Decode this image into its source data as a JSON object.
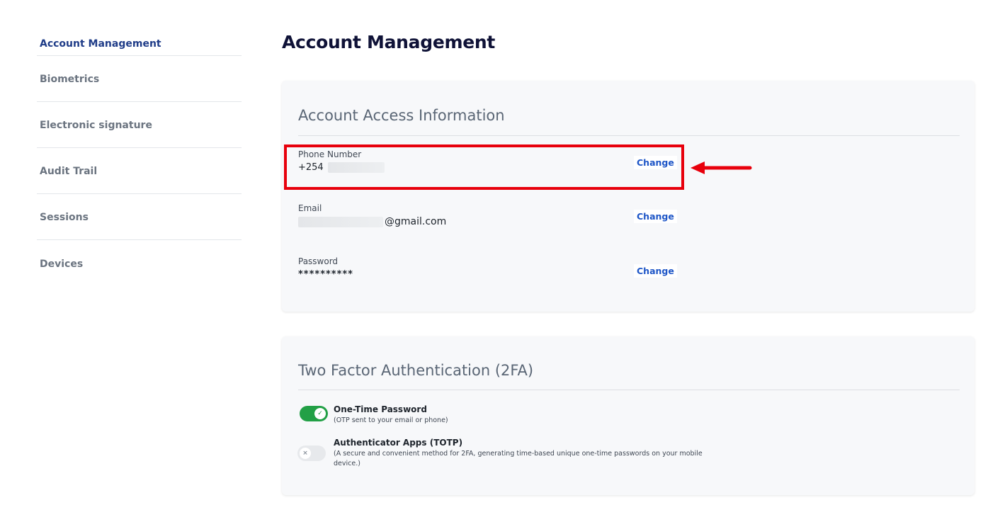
{
  "sidebar": {
    "items": [
      {
        "label": "Account Management"
      },
      {
        "label": "Biometrics"
      },
      {
        "label": "Electronic signature"
      },
      {
        "label": "Audit Trail"
      },
      {
        "label": "Sessions"
      },
      {
        "label": "Devices"
      }
    ],
    "active_color": "#1f3c88",
    "inactive_color": "#6b7480"
  },
  "page": {
    "title": "Account Management"
  },
  "access": {
    "title": "Account Access Information",
    "phone": {
      "label": "Phone Number",
      "value_prefix": "+254",
      "change_label": "Change"
    },
    "email": {
      "label": "Email",
      "value_suffix": "@gmail.com",
      "change_label": "Change"
    },
    "password": {
      "label": "Password",
      "value": "**********",
      "change_label": "Change"
    }
  },
  "twofa": {
    "title": "Two Factor Authentication (2FA)",
    "options": [
      {
        "title": "One-Time Password",
        "description": "(OTP sent to your email or phone)",
        "enabled": true,
        "icon": "check-icon"
      },
      {
        "title": "Authenticator Apps (TOTP)",
        "description": "(A secure and convenient method for 2FA, generating time-based unique one-time passwords on your mobile device.)",
        "enabled": false,
        "icon": "x-icon"
      }
    ]
  },
  "annotation": {
    "highlight_color": "#e8000c"
  }
}
